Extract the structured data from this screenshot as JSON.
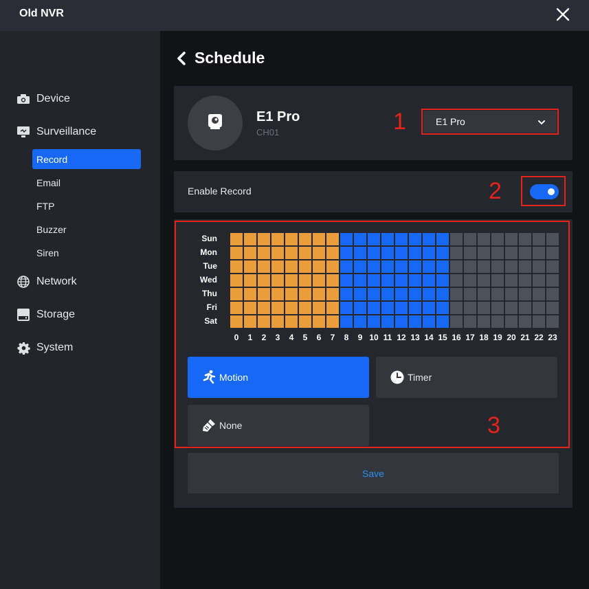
{
  "app": {
    "title": "Old NVR"
  },
  "sidebar": {
    "items": [
      {
        "label": "Device",
        "icon": "camera-icon"
      },
      {
        "label": "Surveillance",
        "icon": "monitor-icon"
      },
      {
        "label": "Network",
        "icon": "globe-icon"
      },
      {
        "label": "Storage",
        "icon": "disk-icon"
      },
      {
        "label": "System",
        "icon": "gear-icon"
      }
    ],
    "subitems": [
      {
        "label": "Record",
        "active": true
      },
      {
        "label": "Email"
      },
      {
        "label": "FTP"
      },
      {
        "label": "Buzzer"
      },
      {
        "label": "Siren"
      }
    ]
  },
  "page": {
    "title": "Schedule"
  },
  "camera": {
    "name": "E1 Pro",
    "channel": "CH01",
    "selected": "E1 Pro"
  },
  "record": {
    "enable_label": "Enable Record",
    "enabled": true
  },
  "schedule": {
    "days": [
      "Sun",
      "Mon",
      "Tue",
      "Wed",
      "Thu",
      "Fri",
      "Sat"
    ],
    "hours": [
      "0",
      "1",
      "2",
      "3",
      "4",
      "5",
      "6",
      "7",
      "8",
      "9",
      "10",
      "11",
      "12",
      "13",
      "14",
      "15",
      "16",
      "17",
      "18",
      "19",
      "20",
      "21",
      "22",
      "23"
    ],
    "hour_modes": [
      "timer",
      "timer",
      "timer",
      "timer",
      "timer",
      "timer",
      "timer",
      "timer",
      "motion",
      "motion",
      "motion",
      "motion",
      "motion",
      "motion",
      "motion",
      "motion",
      "none",
      "none",
      "none",
      "none",
      "none",
      "none",
      "none",
      "none"
    ],
    "colors": {
      "timer": "#eb9d3e",
      "motion": "#1769f5",
      "none": "#4d5159"
    }
  },
  "modes": [
    {
      "label": "Motion",
      "icon": "running-person-icon",
      "active": true
    },
    {
      "label": "Timer",
      "icon": "clock-icon"
    },
    {
      "label": "None",
      "icon": "eraser-brush-icon"
    }
  ],
  "annotations": [
    "1",
    "2",
    "3"
  ],
  "actions": {
    "save_label": "Save"
  }
}
